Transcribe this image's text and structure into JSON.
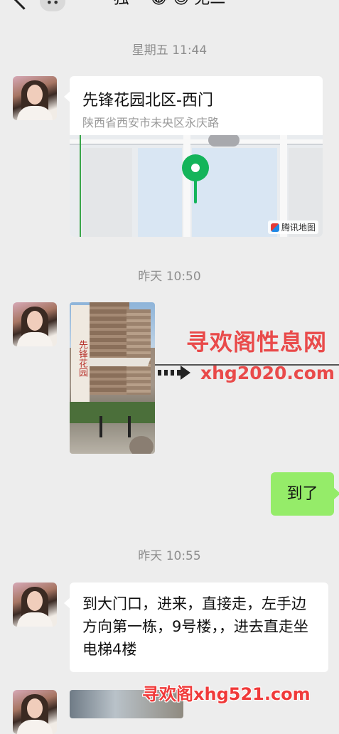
{
  "header": {
    "title": "独一 😂 😍 无二",
    "more_label": "••"
  },
  "messages": {
    "ts1": "星期五 11:44",
    "location": {
      "title": "先锋花园北区-西门",
      "address": "陕西省西安市未央区永庆路",
      "map_provider": "腾讯地图"
    },
    "ts2": "昨天 10:50",
    "photo_sign": "先锋花园",
    "outgoing_text": "到了",
    "ts3": "昨天 10:55",
    "incoming_text": "到大门口，进来，直接走，左手边方向第一栋，9号楼，，进去直走坐电梯4楼"
  },
  "watermarks": {
    "line1": "寻欢阁性息网",
    "url1": "xhg2020.com",
    "bottom": "寻欢阁xhg521.com"
  },
  "colors": {
    "background": "#ededed",
    "outgoing_bubble": "#95ec69",
    "pin": "#14b45a",
    "watermark": "#e94a4a"
  }
}
